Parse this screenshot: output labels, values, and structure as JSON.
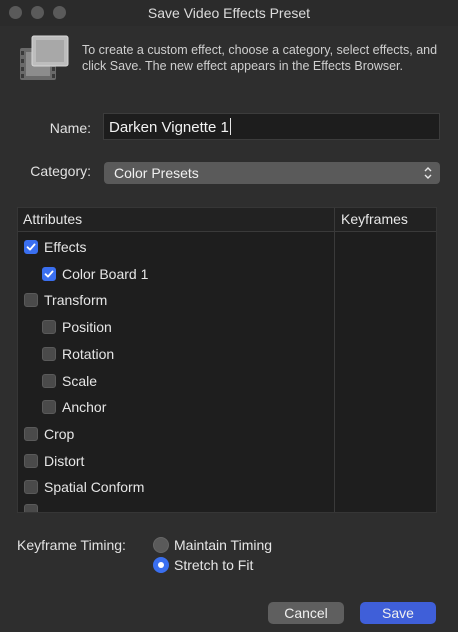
{
  "window": {
    "title": "Save Video Effects Preset"
  },
  "intro": "To create a custom effect, choose a category, select effects, and click Save. The new effect appears in the Effects Browser.",
  "name": {
    "label": "Name:",
    "value": "Darken Vignette 1"
  },
  "category": {
    "label": "Category:",
    "selected": "Color Presets"
  },
  "table": {
    "headers": {
      "attributes": "Attributes",
      "keyframes": "Keyframes"
    },
    "rows": [
      {
        "label": "Effects",
        "checked": true,
        "indent": 0
      },
      {
        "label": "Color Board 1",
        "checked": true,
        "indent": 1
      },
      {
        "label": "Transform",
        "checked": false,
        "indent": 0
      },
      {
        "label": "Position",
        "checked": false,
        "indent": 1
      },
      {
        "label": "Rotation",
        "checked": false,
        "indent": 1
      },
      {
        "label": "Scale",
        "checked": false,
        "indent": 1
      },
      {
        "label": "Anchor",
        "checked": false,
        "indent": 1
      },
      {
        "label": "Crop",
        "checked": false,
        "indent": 0
      },
      {
        "label": "Distort",
        "checked": false,
        "indent": 0
      },
      {
        "label": "Spatial Conform",
        "checked": false,
        "indent": 0
      }
    ]
  },
  "keyframe_timing": {
    "label": "Keyframe Timing:",
    "options": [
      {
        "label": "Maintain Timing",
        "selected": false
      },
      {
        "label": "Stretch to Fit",
        "selected": true
      }
    ]
  },
  "buttons": {
    "cancel": "Cancel",
    "save": "Save"
  },
  "colors": {
    "accent": "#3a6ff0",
    "save_button": "#3f5fd9",
    "background": "#2e2e2e"
  }
}
